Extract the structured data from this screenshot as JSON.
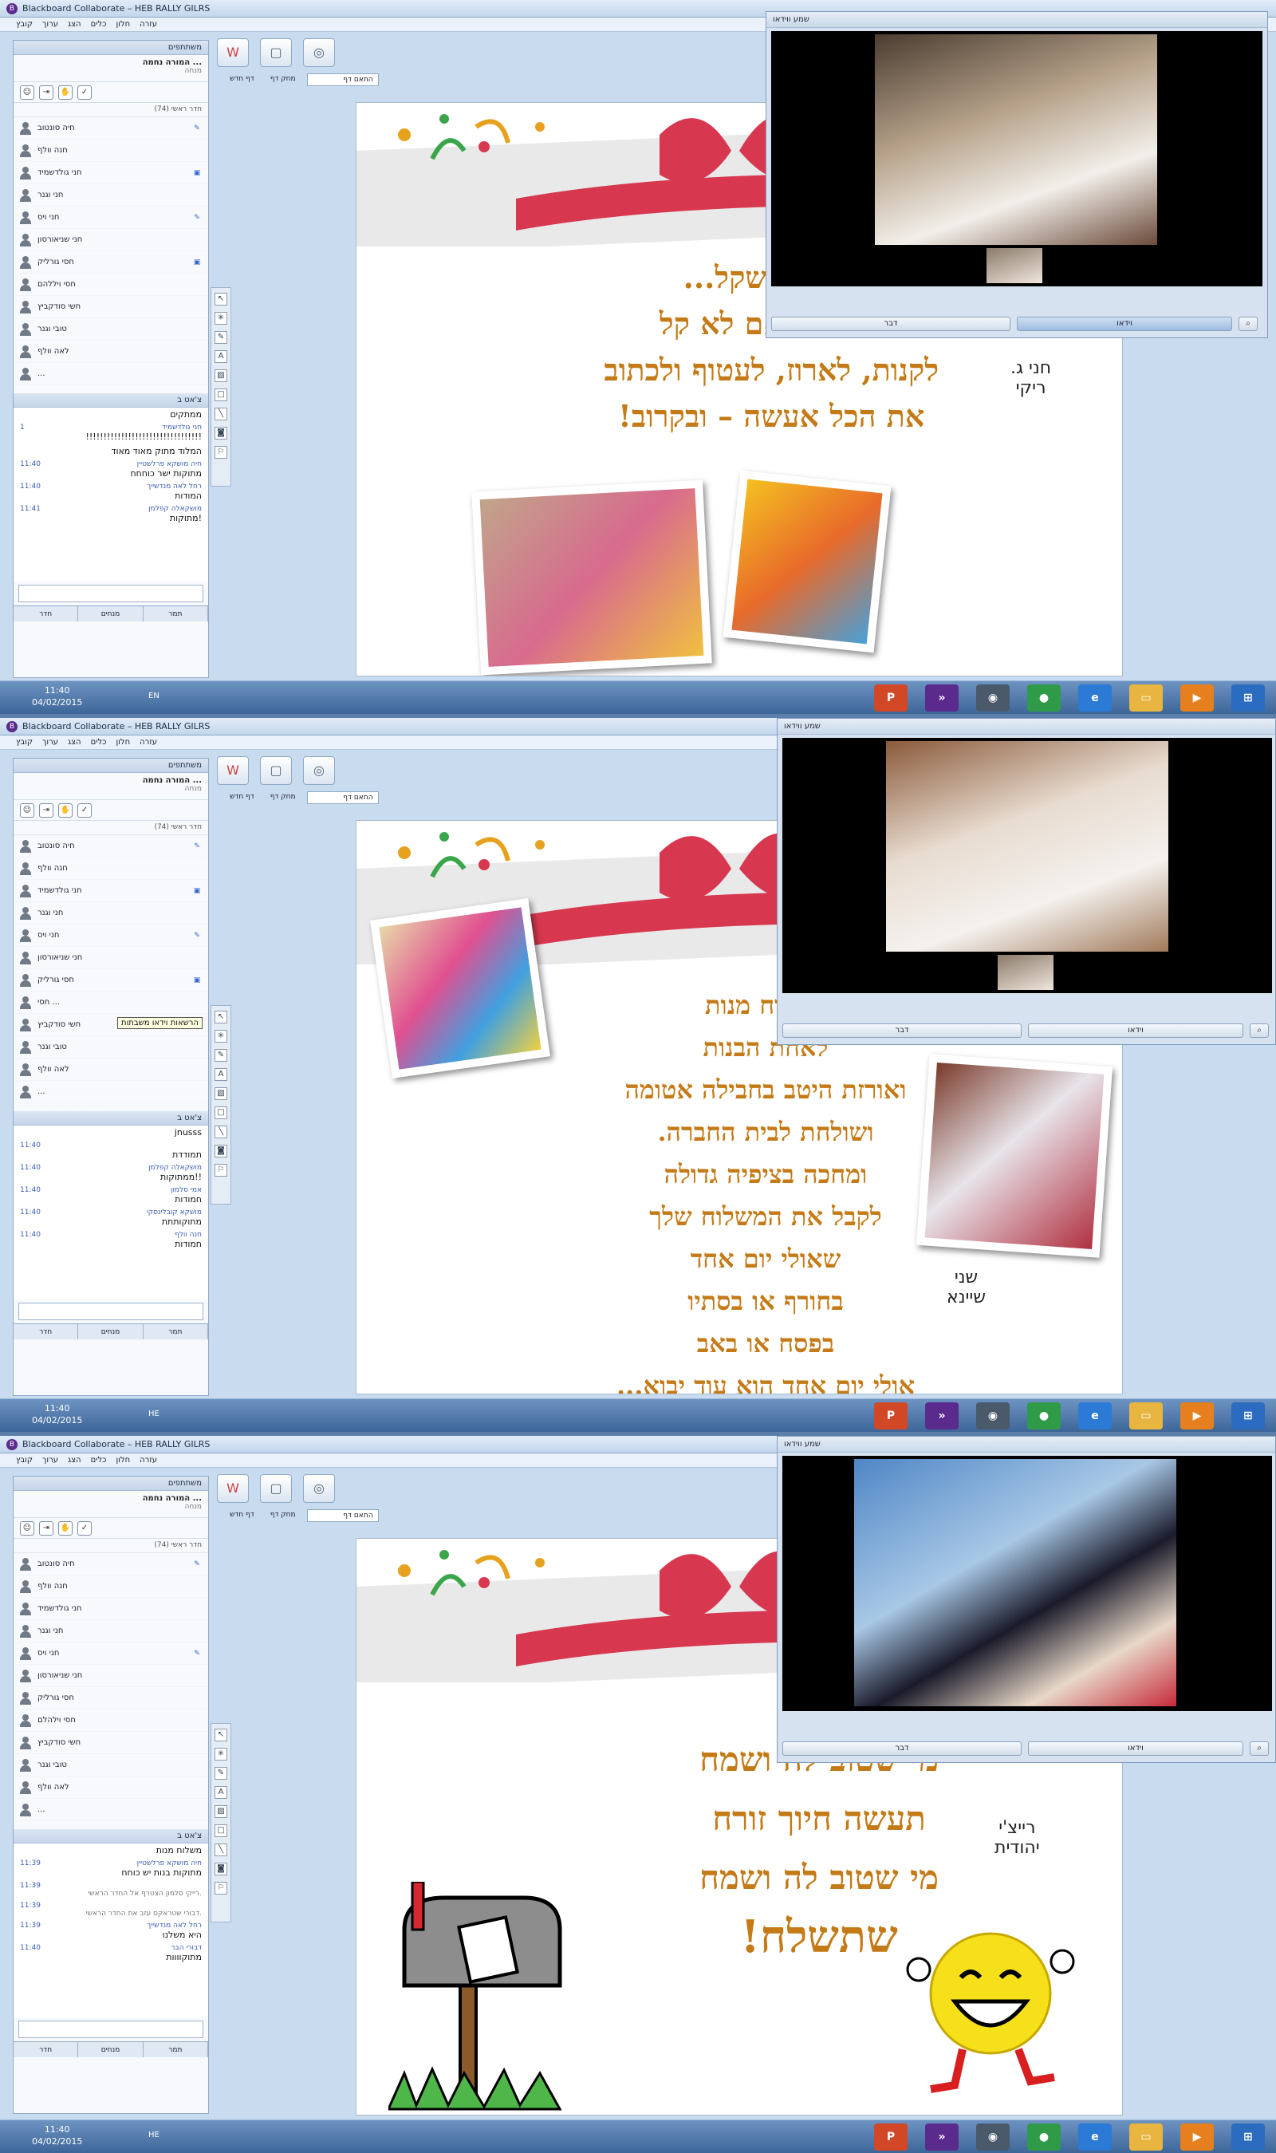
{
  "window_title": "Blackboard Collaborate – HEB RALLY GILRS",
  "menu": [
    "קובץ",
    "ערוך",
    "הצג",
    "כלים",
    "חלון",
    "עזרה"
  ],
  "participants_title": "משתתפים",
  "moderator_name": "המורה נחמה ...",
  "moderator_sub": "מנחה",
  "room_label": "חדר ראשי (74)",
  "chat_title": "צ'אט ב",
  "tabs": {
    "drawer": "דף חדש",
    "page": "מחק דף",
    "fit": "התאם דף"
  },
  "bottom_tabs": [
    "חדר",
    "מנחים",
    "תמר"
  ],
  "video_title": "שמע ווידאו",
  "talk_label": "דבר",
  "video_label": "וידאו",
  "frames": [
    {
      "participants": [
        "חיה סונטוב",
        "חנה וולף",
        "חני גולדשמיד",
        "חני וגנר",
        "חני ויס",
        "חני שניאורסון",
        "חסי גורליק",
        "חסי ויללהם",
        "חשי סודקביץ",
        "טובי וגנר",
        "לאה וולף",
        "..."
      ],
      "chat": [
        {
          "sender": "",
          "time": "",
          "text": "ממתקים"
        },
        {
          "sender": "חני גולדשמיד",
          "time": "1",
          "text": "!!!!!!!!!!!!!!!!!!!!!!!!!!!!!!!!!"
        },
        {
          "sender": "",
          "time": "",
          "text": "המלוד מתוק מאוד מאוד"
        },
        {
          "sender": "חיה מושקא פרלשטיין",
          "time": "11:40",
          "text": "מתוקות ישר כוחחח"
        },
        {
          "sender": "רחל לאה מנדשייך",
          "time": "11:40",
          "text": "המודות"
        },
        {
          "sender": "מושקאלה קפלמן",
          "time": "11:41",
          "text": "מתוקות!"
        }
      ],
      "slide_lines": [
        "הרבה משקל...",
        "מהר גם אם לא קל",
        "לקנות, לארוז, לעטוף ולכתוב",
        "את הכל אעשה – ובקרוב!"
      ],
      "side_names": [
        "חני ג.",
        "ריקי"
      ],
      "clock_time": "11:40",
      "clock_date": "04/02/2015",
      "lang": "EN"
    },
    {
      "participants": [
        "חיה סונטוב",
        "חנה וולף",
        "חני גולדשמיד",
        "חני וגנר",
        "חני ויס",
        "חני שניאורסון",
        "חסי גורליק",
        "חסי ...",
        "חשי סודקביץ",
        "טובי וגנר",
        "לאה וולף",
        "..."
      ],
      "tooltip": "הרשאות וידאו משבתות",
      "chat": [
        {
          "sender": "",
          "time": "",
          "text": "jnusss"
        },
        {
          "sender": "",
          "time": "11:40",
          "text": "תמודדת"
        },
        {
          "sender": "מושקאלה קפלמן",
          "time": "11:40",
          "text": "ממתוקות!!"
        },
        {
          "sender": "אמי סלמון",
          "time": "11:40",
          "text": "חמודות"
        },
        {
          "sender": "מושקא קובלינסקי",
          "time": "11:40",
          "text": "מתוקותתת"
        },
        {
          "sender": "חנה וולף",
          "time": "11:40",
          "text": "חמודות"
        }
      ],
      "slide_lines": [
        "משלוח מנות",
        "לאחת הבנות",
        "ואורזת היטב בחבילה אטומה",
        "ושולחת לבית החברה.",
        "ומחכה בציפיה גדולה",
        "לקבל את המשלוח שלך",
        "שאולי יום אחד",
        "בחורף או בסתיו",
        "בפסח או באב",
        "אולי יום אחד הוא עוד יבוא..."
      ],
      "side_names": [
        "שני",
        "שיינא"
      ],
      "clock_time": "11:40",
      "clock_date": "04/02/2015",
      "lang": "HE"
    },
    {
      "participants": [
        "חיה סונטוב",
        "חנה וולף",
        "חני גולדשמיד",
        "חני וגנר",
        "חני ויס",
        "חני שניאורסון",
        "חסי גורליק",
        "חסי וילהלם",
        "חשי סודקביץ",
        "טובי וגנר",
        "לאה וולף",
        "..."
      ],
      "chat": [
        {
          "sender": "",
          "time": "",
          "text": "משלוח מנות"
        },
        {
          "sender": "חיה מושקא פרלשטיין",
          "time": "11:39",
          "text": "מתוקות בנות יש כוחח"
        },
        {
          "sender": "",
          "time": "11:39",
          "text": "רייקי סלמון הצטרף אל החדר הראשי."
        },
        {
          "sender": "",
          "time": "11:39",
          "text": "דבורי שטראקס עזב את החדר הראשי."
        },
        {
          "sender": "רחל לאה מנדשייך",
          "time": "11:39",
          "text": "היא משלנו"
        },
        {
          "sender": "דבורי הבר",
          "time": "11:40",
          "text": "מתוקוווות"
        }
      ],
      "slide_lines": [
        "מי שטוב לה ושמח",
        "תעשה חיוך זורח",
        "מי שטוב לה ושמח",
        "שתשלח!"
      ],
      "side_names": [
        "רייצ'י",
        "יהודית"
      ],
      "clock_time": "11:40",
      "clock_date": "04/02/2015",
      "lang": "HE"
    }
  ],
  "colors": {
    "slide_text": "#c47a16",
    "ribbon": "#d8384f",
    "taskbar": "#3d6699"
  }
}
